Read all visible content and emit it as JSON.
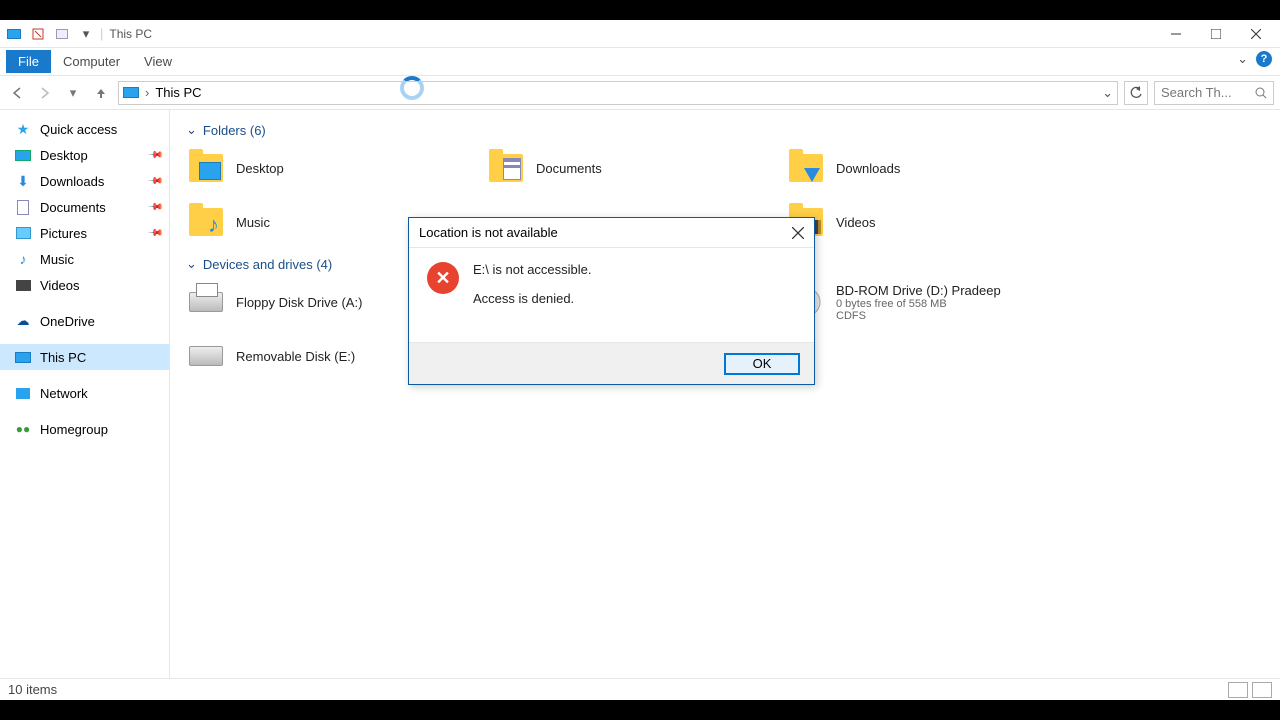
{
  "window_title": "This PC",
  "tabs": {
    "file": "File",
    "computer": "Computer",
    "view": "View"
  },
  "address": {
    "location": "This PC",
    "separator": "›"
  },
  "search": {
    "placeholder": "Search Th..."
  },
  "sidebar": {
    "quick_access": "Quick access",
    "desktop": "Desktop",
    "downloads": "Downloads",
    "documents": "Documents",
    "pictures": "Pictures",
    "music": "Music",
    "videos": "Videos",
    "onedrive": "OneDrive",
    "this_pc": "This PC",
    "network": "Network",
    "homegroup": "Homegroup"
  },
  "groups": {
    "folders": {
      "title": "Folders (6)"
    },
    "drives": {
      "title": "Devices and drives (4)"
    }
  },
  "folders": {
    "desktop": "Desktop",
    "documents": "Documents",
    "downloads": "Downloads",
    "music": "Music",
    "videos": "Videos"
  },
  "drives": {
    "floppy": "Floppy Disk Drive (A:)",
    "bdrom": {
      "label": "BD-ROM Drive (D:) Pradeep",
      "line2": "0 bytes free of 558 MB",
      "line3": "CDFS"
    },
    "removable": "Removable Disk (E:)"
  },
  "status": {
    "items": "10 items"
  },
  "dialog": {
    "title": "Location is not available",
    "line1": "E:\\ is not accessible.",
    "line2": "Access is denied.",
    "ok": "OK"
  }
}
